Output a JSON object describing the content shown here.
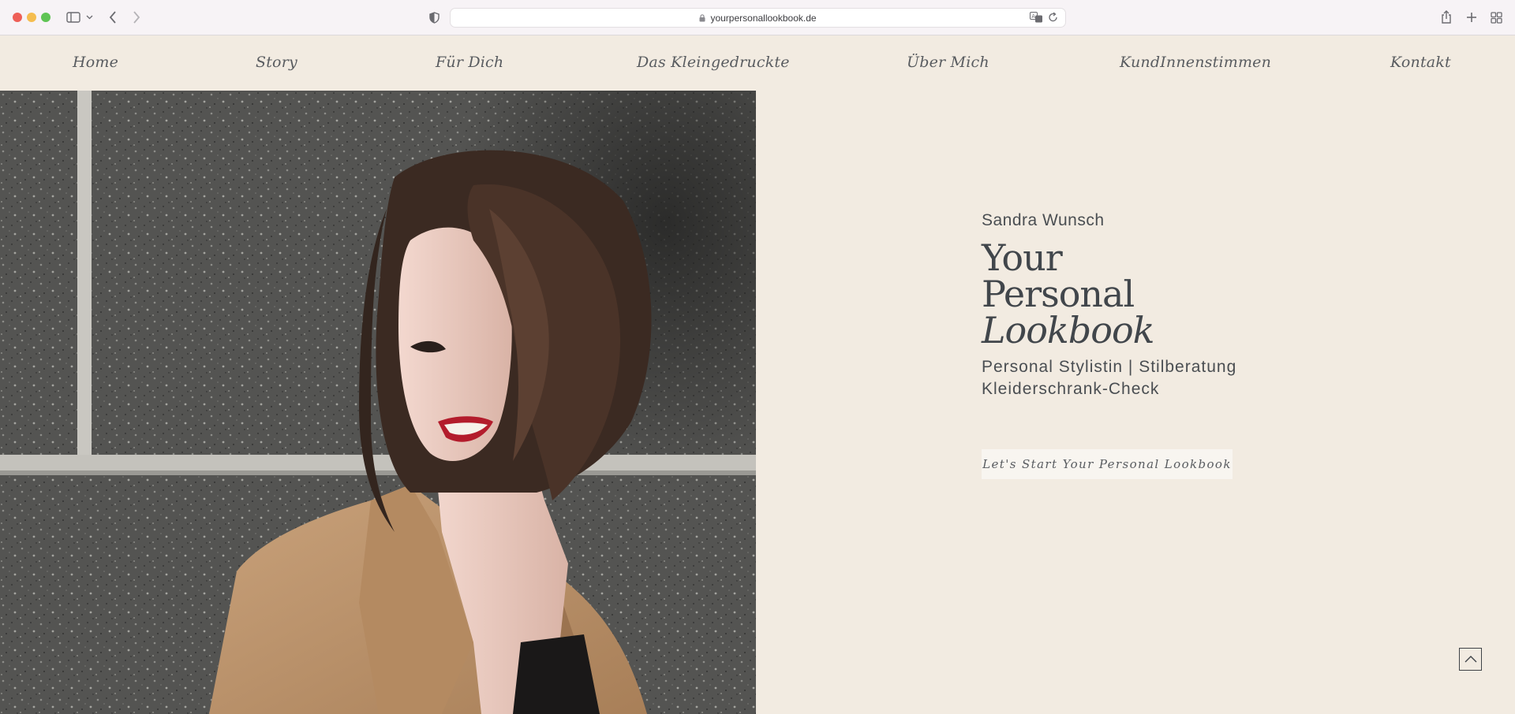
{
  "browser": {
    "url": "yourpersonallookbook.de",
    "icons": [
      "sidebar-icon",
      "chevron-down-icon",
      "back-icon",
      "forward-icon",
      "shield-icon",
      "lock-icon",
      "translate-icon",
      "reload-icon",
      "share-icon",
      "plus-icon",
      "tabs-icon"
    ]
  },
  "nav": {
    "items": [
      {
        "label": "Home"
      },
      {
        "label": "Story"
      },
      {
        "label": "Für Dich"
      },
      {
        "label": "Das Kleingedruckte"
      },
      {
        "label": "Über Mich"
      },
      {
        "label": "KundInnenstimmen"
      },
      {
        "label": "Kontakt"
      }
    ]
  },
  "hero": {
    "name": "Sandra Wunsch",
    "title_line1": "Your",
    "title_line2": "Personal",
    "title_line3": "Lookbook",
    "subtitle_line1": "Personal Stylistin | Stilberatung",
    "subtitle_line2": "Kleiderschrank-Check",
    "cta_label": "Let's Start Your Personal Lookbook"
  },
  "colors": {
    "page_background": "#f2ebe1",
    "text": "#3f4347",
    "button_background": "#f8f5f0"
  }
}
